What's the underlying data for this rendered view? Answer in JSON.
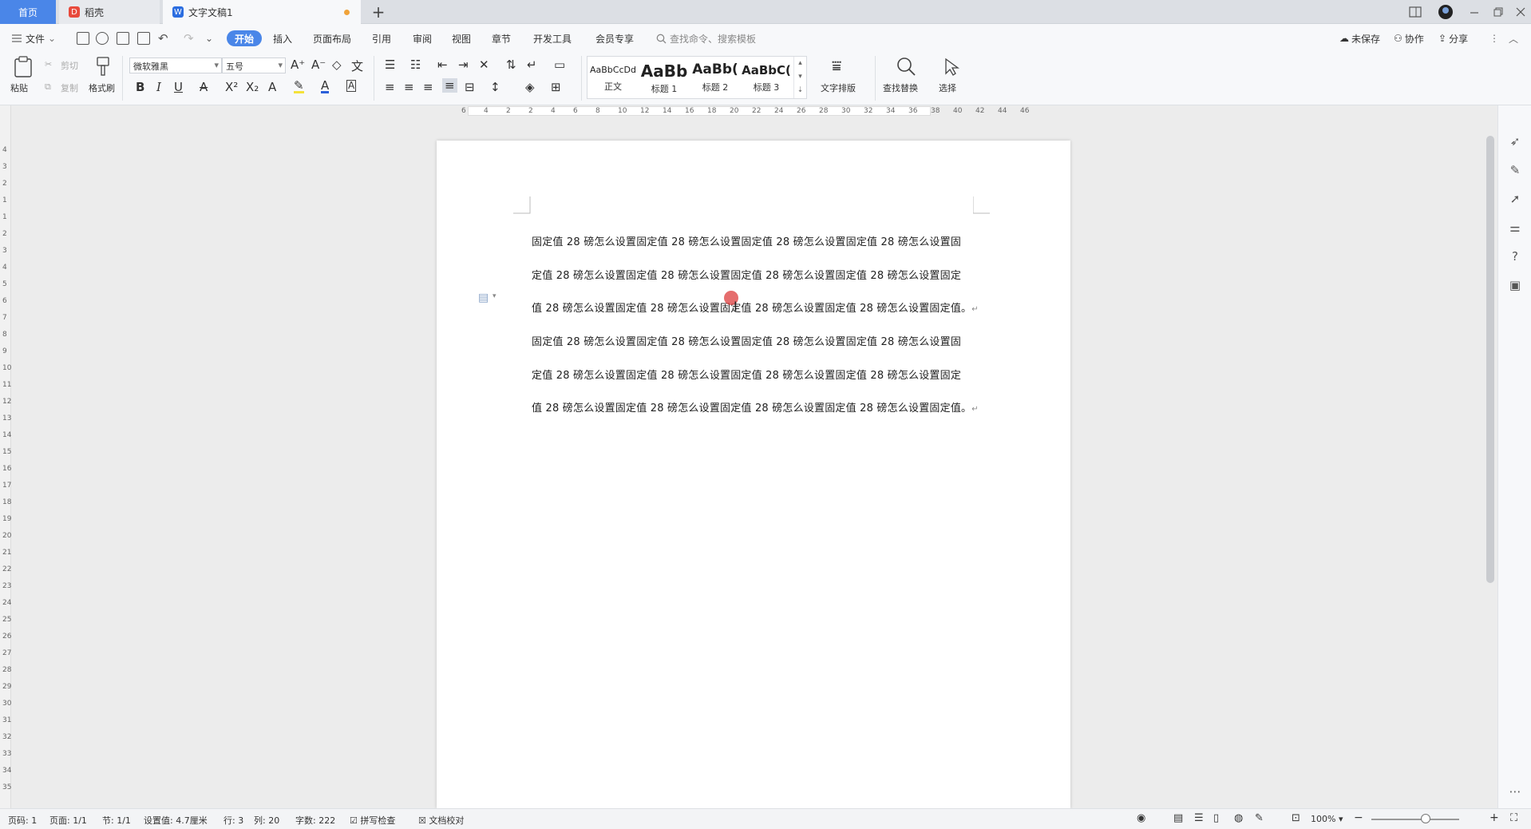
{
  "tabs": {
    "home": "首页",
    "daoke": "稻壳",
    "doc": "文字文稿1",
    "add": "+"
  },
  "menu": {
    "file": "文件",
    "items": [
      "开始",
      "插入",
      "页面布局",
      "引用",
      "审阅",
      "视图",
      "章节",
      "开发工具",
      "会员专享"
    ],
    "search_placeholder": "查找命令、搜索模板",
    "unsaved": "未保存",
    "collab": "协作",
    "share": "分享"
  },
  "ribbon": {
    "paste": "粘贴",
    "cut": "剪切",
    "copy": "复制",
    "format_painter": "格式刷",
    "font_name": "微软雅黑",
    "font_size": "五号",
    "styles": [
      {
        "sample": "AaBbCcDd",
        "label": "正文"
      },
      {
        "sample": "AaBb",
        "label": "标题 1"
      },
      {
        "sample": "AaBb(",
        "label": "标题 2"
      },
      {
        "sample": "AaBbC(",
        "label": "标题 3"
      }
    ],
    "text_layout": "文字排版",
    "find_replace": "查找替换",
    "select": "选择"
  },
  "ruler": {
    "h_ticks": [
      "6",
      "4",
      "2",
      "2",
      "4",
      "6",
      "8",
      "10",
      "12",
      "14",
      "16",
      "18",
      "20",
      "22",
      "24",
      "26",
      "28",
      "30",
      "32",
      "34",
      "36",
      "38",
      "40",
      "42",
      "44",
      "46"
    ],
    "v_ticks": [
      "4",
      "3",
      "2",
      "1",
      "1",
      "2",
      "3",
      "4",
      "5",
      "6",
      "7",
      "8",
      "9",
      "10",
      "11",
      "12",
      "13",
      "14",
      "15",
      "16",
      "17",
      "18",
      "19",
      "20",
      "21",
      "22",
      "23",
      "24",
      "25",
      "26",
      "27",
      "28",
      "29",
      "30",
      "31",
      "32",
      "33",
      "34",
      "35"
    ]
  },
  "document": {
    "lines": [
      "固定值 28 磅怎么设置固定值 28 磅怎么设置固定值 28 磅怎么设置固定值 28 磅怎么设置固",
      "定值 28 磅怎么设置固定值 28 磅怎么设置固定值 28 磅怎么设置固定值 28 磅怎么设置固定",
      "值 28 磅怎么设置固定值 28 磅怎么设置固定值 28 磅怎么设置固定值 28 磅怎么设置固定值。",
      "固定值 28 磅怎么设置固定值 28 磅怎么设置固定值 28 磅怎么设置固定值 28 磅怎么设置固",
      "定值 28 磅怎么设置固定值 28 磅怎么设置固定值 28 磅怎么设置固定值 28 磅怎么设置固定",
      "值 28 磅怎么设置固定值 28 磅怎么设置固定值 28 磅怎么设置固定值 28 磅怎么设置固定值。"
    ],
    "para_mark": "↵"
  },
  "status": {
    "page_num": "页码: 1",
    "pages": "页面: 1/1",
    "section": "节: 1/1",
    "setting": "设置值: 4.7厘米",
    "row": "行: 3",
    "col": "列: 20",
    "words": "字数: 222",
    "spell": "拼写检查",
    "proof": "文档校对",
    "zoom": "100%"
  },
  "colors": {
    "accent": "#4a86e8",
    "brand_red": "#e84a3c",
    "unsaved_dot": "#f0a33a"
  }
}
